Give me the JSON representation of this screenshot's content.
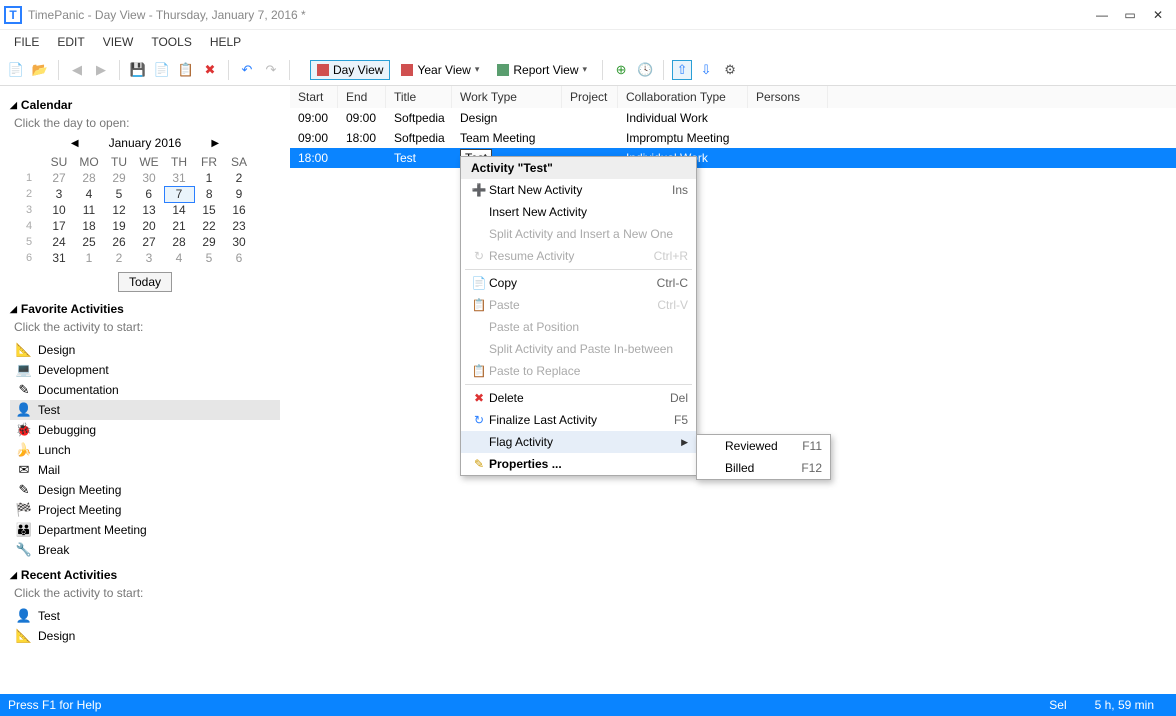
{
  "title": "TimePanic - Day View - Thursday, January 7, 2016 *",
  "menubar": [
    "FILE",
    "EDIT",
    "VIEW",
    "TOOLS",
    "HELP"
  ],
  "toolbar_views": {
    "day": "Day View",
    "year": "Year View",
    "report": "Report View"
  },
  "sidebar": {
    "calendar_head": "Calendar",
    "calendar_hint": "Click the day to open:",
    "cal_title": "January 2016",
    "dow": [
      "SU",
      "MO",
      "TU",
      "WE",
      "TH",
      "FR",
      "SA"
    ],
    "weeks": [
      {
        "wk": "1",
        "d": [
          "27",
          "28",
          "29",
          "30",
          "31",
          "1",
          "2"
        ],
        "other": [
          0,
          1,
          2,
          3,
          4
        ]
      },
      {
        "wk": "2",
        "d": [
          "3",
          "4",
          "5",
          "6",
          "7",
          "8",
          "9"
        ],
        "today": 4
      },
      {
        "wk": "3",
        "d": [
          "10",
          "11",
          "12",
          "13",
          "14",
          "15",
          "16"
        ]
      },
      {
        "wk": "4",
        "d": [
          "17",
          "18",
          "19",
          "20",
          "21",
          "22",
          "23"
        ]
      },
      {
        "wk": "5",
        "d": [
          "24",
          "25",
          "26",
          "27",
          "28",
          "29",
          "30"
        ]
      },
      {
        "wk": "6",
        "d": [
          "31",
          "1",
          "2",
          "3",
          "4",
          "5",
          "6"
        ],
        "other": [
          1,
          2,
          3,
          4,
          5,
          6
        ]
      }
    ],
    "today_btn": "Today",
    "fav_head": "Favorite Activities",
    "fav_hint": "Click the activity to start:",
    "favorites": [
      {
        "icon": "📐",
        "label": "Design"
      },
      {
        "icon": "💻",
        "label": "Development"
      },
      {
        "icon": "✎",
        "label": "Documentation"
      },
      {
        "icon": "👤",
        "label": "Test",
        "selected": true
      },
      {
        "icon": "🐞",
        "label": "Debugging"
      },
      {
        "icon": "🍌",
        "label": "Lunch"
      },
      {
        "icon": "✉",
        "label": "Mail"
      },
      {
        "icon": "✎",
        "label": "Design Meeting"
      },
      {
        "icon": "🏁",
        "label": "Project Meeting"
      },
      {
        "icon": "👪",
        "label": "Department Meeting"
      },
      {
        "icon": "🔧",
        "label": "Break"
      }
    ],
    "recent_head": "Recent Activities",
    "recent_hint": "Click the activity to start:",
    "recent": [
      {
        "icon": "👤",
        "label": "Test"
      },
      {
        "icon": "📐",
        "label": "Design"
      }
    ]
  },
  "columns": [
    "Start",
    "End",
    "Title",
    "Work Type",
    "Project",
    "Collaboration Type",
    "Persons"
  ],
  "rows": [
    {
      "start": "09:00",
      "end": "09:00",
      "title": "Softpedia",
      "work": "Design",
      "proj": "",
      "collab": "Individual Work",
      "pers": ""
    },
    {
      "start": "09:00",
      "end": "18:00",
      "title": "Softpedia",
      "work": "Team Meeting",
      "proj": "",
      "collab": "Impromptu Meeting",
      "pers": ""
    },
    {
      "start": "18:00",
      "end": "",
      "title": "Test",
      "work": "Test",
      "proj": "",
      "collab": "Individual Work",
      "pers": "",
      "selected": true,
      "editing": "work"
    }
  ],
  "ctx": {
    "head": "Activity \"Test\"",
    "items": [
      {
        "icon": "➕",
        "label": "Start New Activity",
        "cut": "Ins"
      },
      {
        "label": "Insert New Activity"
      },
      {
        "label": "Split Activity and Insert a New One",
        "disabled": true
      },
      {
        "icon": "↻",
        "label": "Resume Activity",
        "cut": "Ctrl+R",
        "disabled": true
      },
      {
        "sep": true
      },
      {
        "icon": "📄",
        "label": "Copy",
        "cut": "Ctrl-C"
      },
      {
        "icon": "📋",
        "label": "Paste",
        "cut": "Ctrl-V",
        "disabled": true
      },
      {
        "label": "Paste at Position",
        "disabled": true
      },
      {
        "label": "Split Activity and Paste In-between",
        "disabled": true
      },
      {
        "icon": "📋",
        "label": "Paste to Replace",
        "disabled": true
      },
      {
        "sep": true
      },
      {
        "icon": "✖",
        "iconColor": "#d33",
        "label": "Delete",
        "cut": "Del"
      },
      {
        "icon": "↻",
        "iconColor": "#2a7fff",
        "label": "Finalize Last Activity",
        "cut": "F5"
      },
      {
        "label": "Flag Activity",
        "submenu": true,
        "hover": true
      },
      {
        "icon": "✎",
        "iconColor": "#c90",
        "label": "Properties ...",
        "bold": true
      }
    ]
  },
  "submenu": [
    {
      "label": "Reviewed",
      "cut": "F11"
    },
    {
      "label": "Billed",
      "cut": "F12"
    }
  ],
  "status": {
    "help": "Press F1 for Help",
    "sel": "Sel",
    "time": "5 h, 59 min"
  }
}
